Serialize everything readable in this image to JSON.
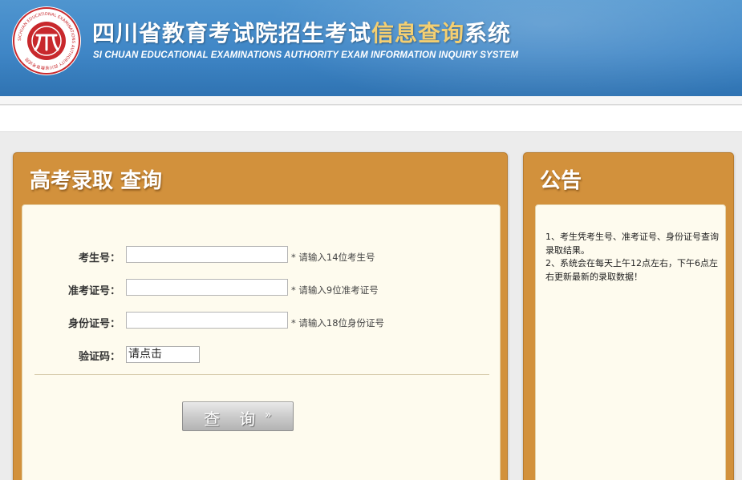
{
  "header": {
    "title_part1": "四川省教育考试院招生考试",
    "title_highlight": "信息查询",
    "title_part2": "系统",
    "subtitle_en": "SI CHUAN EDUCATIONAL EXAMINATIONS AUTHORITY EXAM INFORMATION INQUIRY SYSTEM",
    "logo": {
      "icon": "sichuan-education-exam-authority-seal",
      "ring_text": "SICHUAN EDUCATIONAL EXAMINATIONS AUTHORITY 四川省教育考试院"
    }
  },
  "query_panel": {
    "title": "高考录取 查询",
    "fields": [
      {
        "label": "考生号：",
        "value": "",
        "hint": "* 请输入14位考生号"
      },
      {
        "label": "准考证号：",
        "value": "",
        "hint": "* 请输入9位准考证号"
      },
      {
        "label": "身份证号：",
        "value": "",
        "hint": "* 请输入18位身份证号"
      }
    ],
    "captcha": {
      "label": "验证码：",
      "value": "请点击"
    },
    "submit": {
      "label": "查 询",
      "icon": "double-chevron-right-icon",
      "glyph": "»"
    }
  },
  "notice_panel": {
    "title": "公告",
    "items": [
      "1、考生凭考生号、准考证号、身份证号查询录取结果。",
      "2、系统会在每天上午12点左右，下午6点左右更新最新的录取数据！"
    ]
  },
  "colors": {
    "header_blue": "#3f86c6",
    "title_highlight": "#f4cf71",
    "panel_orange": "#d2913c",
    "panel_body": "#fefbee",
    "logo_red": "#c8282c"
  }
}
